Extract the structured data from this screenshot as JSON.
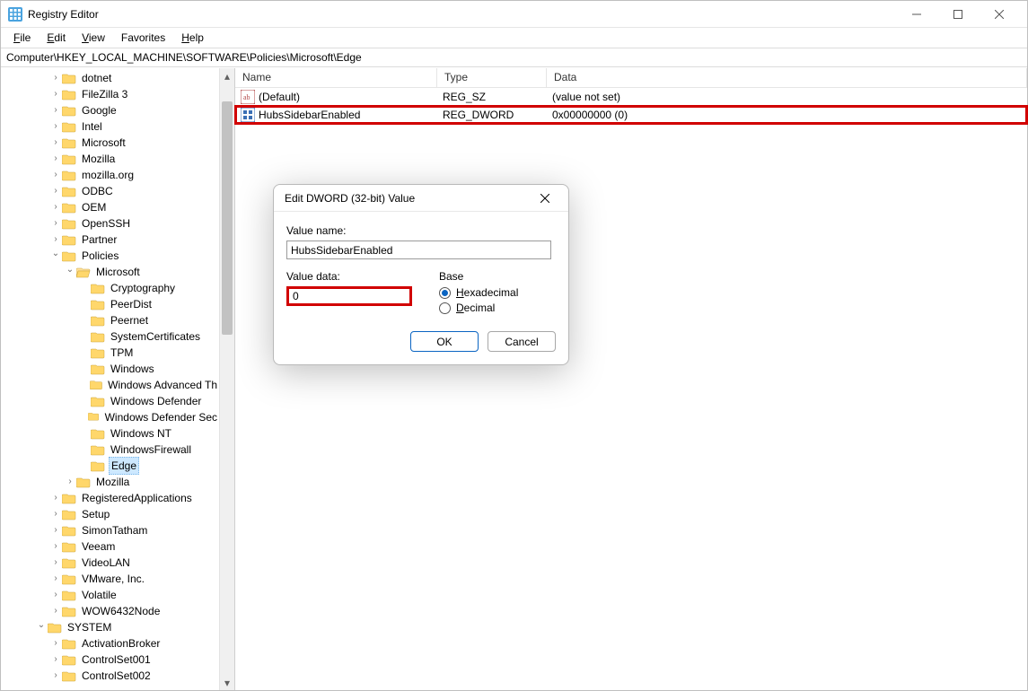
{
  "window": {
    "title": "Registry Editor"
  },
  "menu": {
    "file": "File",
    "edit": "Edit",
    "view": "View",
    "favorites": "Favorites",
    "help": "Help"
  },
  "address": "Computer\\HKEY_LOCAL_MACHINE\\SOFTWARE\\Policies\\Microsoft\\Edge",
  "columns": {
    "name": "Name",
    "type": "Type",
    "data": "Data"
  },
  "values": [
    {
      "kind": "sz",
      "name": "(Default)",
      "type": "REG_SZ",
      "data": "(value not set)"
    },
    {
      "kind": "dword",
      "name": "HubsSidebarEnabled",
      "type": "REG_DWORD",
      "data": "0x00000000 (0)"
    }
  ],
  "tree": [
    {
      "indent": 3,
      "twist": "closed",
      "label": "dotnet"
    },
    {
      "indent": 3,
      "twist": "closed",
      "label": "FileZilla 3"
    },
    {
      "indent": 3,
      "twist": "closed",
      "label": "Google"
    },
    {
      "indent": 3,
      "twist": "closed",
      "label": "Intel"
    },
    {
      "indent": 3,
      "twist": "closed",
      "label": "Microsoft"
    },
    {
      "indent": 3,
      "twist": "closed",
      "label": "Mozilla"
    },
    {
      "indent": 3,
      "twist": "closed",
      "label": "mozilla.org"
    },
    {
      "indent": 3,
      "twist": "closed",
      "label": "ODBC"
    },
    {
      "indent": 3,
      "twist": "closed",
      "label": "OEM"
    },
    {
      "indent": 3,
      "twist": "closed",
      "label": "OpenSSH"
    },
    {
      "indent": 3,
      "twist": "closed",
      "label": "Partner"
    },
    {
      "indent": 3,
      "twist": "open",
      "label": "Policies"
    },
    {
      "indent": 4,
      "twist": "open",
      "label": "Microsoft",
      "open": true
    },
    {
      "indent": 5,
      "twist": "none",
      "label": "Cryptography"
    },
    {
      "indent": 5,
      "twist": "none",
      "label": "PeerDist"
    },
    {
      "indent": 5,
      "twist": "none",
      "label": "Peernet"
    },
    {
      "indent": 5,
      "twist": "none",
      "label": "SystemCertificates"
    },
    {
      "indent": 5,
      "twist": "none",
      "label": "TPM"
    },
    {
      "indent": 5,
      "twist": "none",
      "label": "Windows"
    },
    {
      "indent": 5,
      "twist": "none",
      "label": "Windows Advanced Th"
    },
    {
      "indent": 5,
      "twist": "none",
      "label": "Windows Defender"
    },
    {
      "indent": 5,
      "twist": "none",
      "label": "Windows Defender Sec"
    },
    {
      "indent": 5,
      "twist": "none",
      "label": "Windows NT"
    },
    {
      "indent": 5,
      "twist": "none",
      "label": "WindowsFirewall"
    },
    {
      "indent": 5,
      "twist": "none",
      "label": "Edge",
      "selected": true
    },
    {
      "indent": 4,
      "twist": "closed",
      "label": "Mozilla"
    },
    {
      "indent": 3,
      "twist": "closed",
      "label": "RegisteredApplications"
    },
    {
      "indent": 3,
      "twist": "closed",
      "label": "Setup"
    },
    {
      "indent": 3,
      "twist": "closed",
      "label": "SimonTatham"
    },
    {
      "indent": 3,
      "twist": "closed",
      "label": "Veeam"
    },
    {
      "indent": 3,
      "twist": "closed",
      "label": "VideoLAN"
    },
    {
      "indent": 3,
      "twist": "closed",
      "label": "VMware, Inc."
    },
    {
      "indent": 3,
      "twist": "closed",
      "label": "Volatile"
    },
    {
      "indent": 3,
      "twist": "closed",
      "label": "WOW6432Node"
    },
    {
      "indent": 2,
      "twist": "open",
      "label": "SYSTEM"
    },
    {
      "indent": 3,
      "twist": "closed",
      "label": "ActivationBroker"
    },
    {
      "indent": 3,
      "twist": "closed",
      "label": "ControlSet001"
    },
    {
      "indent": 3,
      "twist": "closed",
      "label": "ControlSet002"
    }
  ],
  "dialog": {
    "title": "Edit DWORD (32-bit) Value",
    "value_name_label": "Value name:",
    "value_name": "HubsSidebarEnabled",
    "value_data_label": "Value data:",
    "value_data": "0",
    "base_label": "Base",
    "hex_label": "Hexadecimal",
    "dec_label": "Decimal",
    "base_selected": "hex",
    "ok": "OK",
    "cancel": "Cancel"
  }
}
